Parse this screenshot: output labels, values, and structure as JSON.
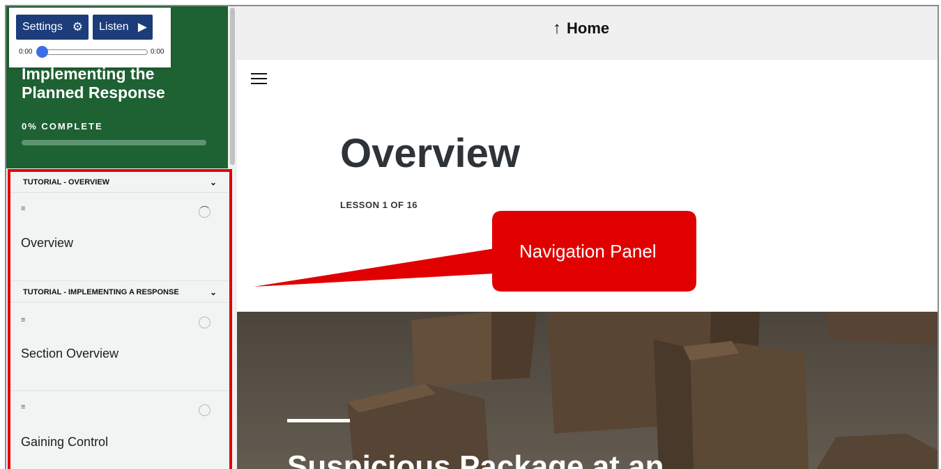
{
  "audio": {
    "settings_label": "Settings",
    "listen_label": "Listen",
    "time_current": "0:00",
    "time_total": "0:00",
    "position_fraction": 0
  },
  "course": {
    "title": "Implementing the Planned Response",
    "progress_label": "0% COMPLETE",
    "progress_percent": 0
  },
  "sections": [
    {
      "title": "TUTORIAL - OVERVIEW",
      "lessons": [
        {
          "title": "Overview",
          "status": "in-progress"
        }
      ]
    },
    {
      "title": "TUTORIAL - IMPLEMENTING A RESPONSE",
      "lessons": [
        {
          "title": "Section Overview",
          "status": "not-started"
        },
        {
          "title": "Gaining Control",
          "status": "not-started"
        }
      ]
    }
  ],
  "topbar": {
    "home_label": "Home"
  },
  "lesson": {
    "heading": "Overview",
    "counter": "LESSON 1 OF 16"
  },
  "annotation": {
    "callout_text": "Navigation Panel",
    "color": "#e10000"
  },
  "hero": {
    "title": "Suspicious Package at an"
  },
  "colors": {
    "sidebar_header": "#1e6132",
    "button": "#1d3c7a",
    "slider_knob": "#3b6fe8"
  }
}
